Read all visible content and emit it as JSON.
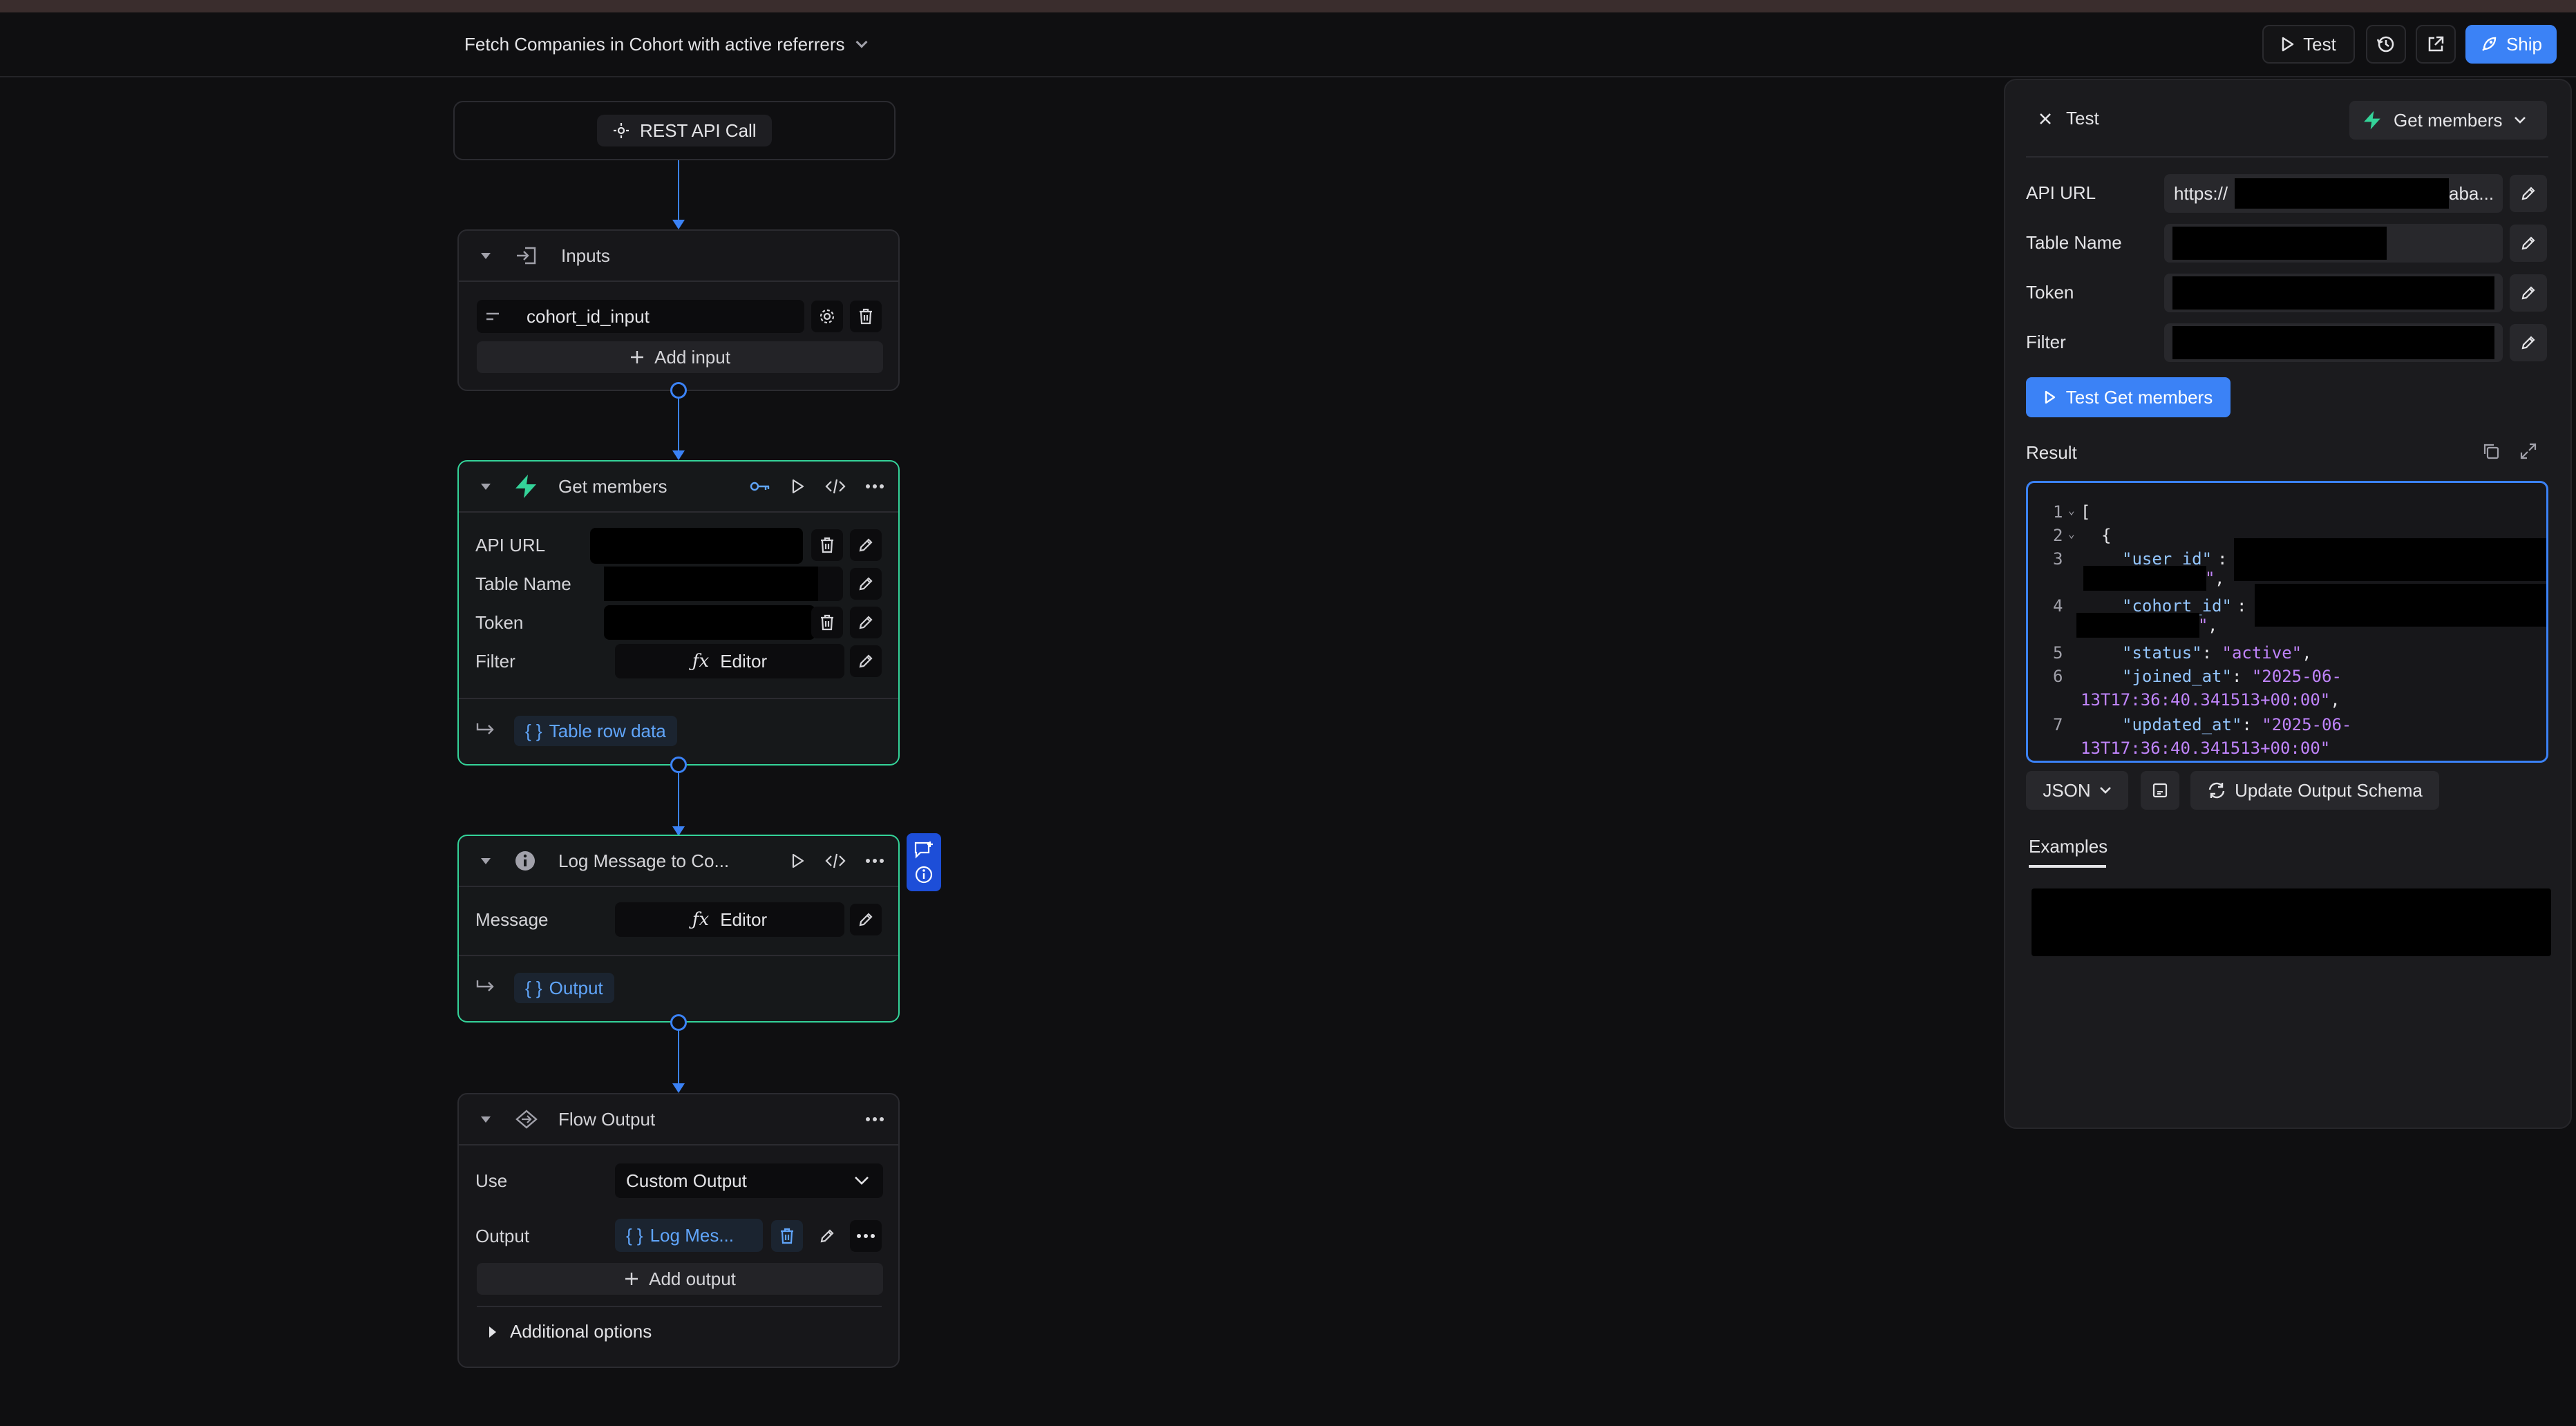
{
  "header": {
    "flow_title": "Fetch Companies in Cohort with active referrers",
    "test_label": "Test",
    "ship_label": "Ship"
  },
  "canvas": {
    "rest_node": {
      "label": "REST API Call"
    },
    "inputs_node": {
      "title": "Inputs",
      "input_name": "cohort_id_input",
      "add_input_label": "Add input"
    },
    "get_members_node": {
      "title": "Get members",
      "rows": [
        "API URL",
        "Table Name",
        "Token",
        "Filter"
      ],
      "filter_value": "Editor",
      "output_tag": "Table row data"
    },
    "log_node": {
      "title": "Log Message to Co...",
      "message_label": "Message",
      "message_value": "Editor",
      "output_tag": "Output"
    },
    "flow_output_node": {
      "title": "Flow Output",
      "use_label": "Use",
      "use_value": "Custom Output",
      "output_label": "Output",
      "output_value": "Log Mes...",
      "add_output_label": "Add output",
      "additional_options_label": "Additional options"
    }
  },
  "test_panel": {
    "title": "Test",
    "node_select": "Get members",
    "fields": {
      "api_url_label": "API URL",
      "api_url_prefix": "https://",
      "api_url_suffix": "aba...",
      "table_name_label": "Table Name",
      "token_label": "Token",
      "filter_label": "Filter"
    },
    "test_button": "Test Get members",
    "result_label": "Result",
    "code": {
      "line_numbers": [
        "1",
        "2",
        "3",
        "4",
        "5",
        "6",
        "7"
      ],
      "open_bracket": "[",
      "open_brace": "{",
      "k_user_id": "\"user_id\"",
      "k_cohort_id": "\"cohort_id\"",
      "k_status": "\"status\"",
      "v_status": "\"active\"",
      "k_joined_at": "\"joined_at\"",
      "v_joined_at_1": "\"2025-06-",
      "v_joined_at_2": "13T17:36:40.341513+00:00\"",
      "k_updated_at": "\"updated_at\"",
      "v_updated_at_1": "\"2025-06-",
      "v_updated_at_2": "13T17:36:40.341513+00:00\""
    },
    "format_select": "JSON",
    "update_schema_label": "Update Output Schema",
    "examples_tab": "Examples"
  }
}
